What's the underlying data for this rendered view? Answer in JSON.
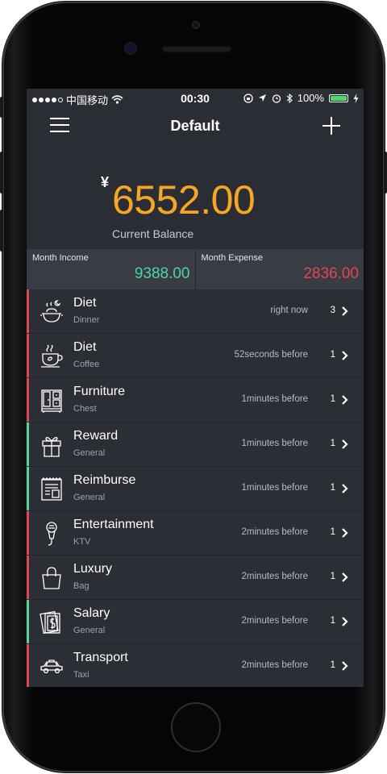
{
  "status_bar": {
    "carrier": "中国移动",
    "time": "00:30",
    "battery": "100%"
  },
  "nav": {
    "title": "Default"
  },
  "balance": {
    "currency": "¥",
    "amount": "6552.00",
    "label": "Current Balance"
  },
  "month": {
    "income_label": "Month Income",
    "income_value": "9388.00",
    "expense_label": "Month Expense",
    "expense_value": "2836.00"
  },
  "colors": {
    "accent_orange": "#f5a623",
    "income_green": "#4ad7a0",
    "expense_red": "#e0464e"
  },
  "transactions": [
    {
      "category": "Diet",
      "subcategory": "Dinner",
      "time": "right now",
      "count": "3",
      "type": "expense",
      "icon": "dinner-pot-icon"
    },
    {
      "category": "Diet",
      "subcategory": "Coffee",
      "time": "52seconds before",
      "count": "1",
      "type": "expense",
      "icon": "coffee-cup-icon"
    },
    {
      "category": "Furniture",
      "subcategory": "Chest",
      "time": "1minutes before",
      "count": "1",
      "type": "expense",
      "icon": "chest-icon"
    },
    {
      "category": "Reward",
      "subcategory": "General",
      "time": "1minutes before",
      "count": "1",
      "type": "income",
      "icon": "gift-icon"
    },
    {
      "category": "Reimburse",
      "subcategory": "General",
      "time": "1minutes before",
      "count": "1",
      "type": "income",
      "icon": "receipt-icon"
    },
    {
      "category": "Entertainment",
      "subcategory": "KTV",
      "time": "2minutes before",
      "count": "1",
      "type": "expense",
      "icon": "microphone-icon"
    },
    {
      "category": "Luxury",
      "subcategory": "Bag",
      "time": "2minutes before",
      "count": "1",
      "type": "expense",
      "icon": "bag-icon"
    },
    {
      "category": "Salary",
      "subcategory": "General",
      "time": "2minutes before",
      "count": "1",
      "type": "income",
      "icon": "money-icon"
    },
    {
      "category": "Transport",
      "subcategory": "Taxi",
      "time": "2minutes before",
      "count": "1",
      "type": "expense",
      "icon": "taxi-icon"
    }
  ]
}
